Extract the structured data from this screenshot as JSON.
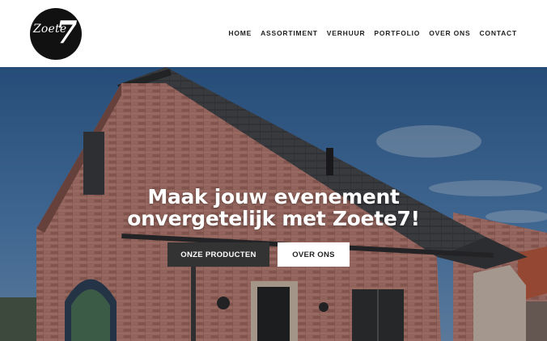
{
  "header": {
    "logo": {
      "word": "Zoete",
      "number": "7"
    },
    "nav": [
      {
        "label": "HOME"
      },
      {
        "label": "ASSORTIMENT"
      },
      {
        "label": "VERHUUR"
      },
      {
        "label": "PORTFOLIO"
      },
      {
        "label": "OVER ONS"
      },
      {
        "label": "CONTACT"
      }
    ]
  },
  "hero": {
    "title_line1": "Maak jouw evenement",
    "title_line2": "onvergetelijk met Zoete7!",
    "primary_button": "ONZE PRODUCTEN",
    "secondary_button": "OVER ONS"
  },
  "colors": {
    "nav_text": "#222222",
    "primary_button_bg": "#333333",
    "secondary_button_bg": "#ffffff",
    "sky": "#3f6fa3",
    "brick": "#a86f66",
    "roof": "#3a3c40"
  }
}
